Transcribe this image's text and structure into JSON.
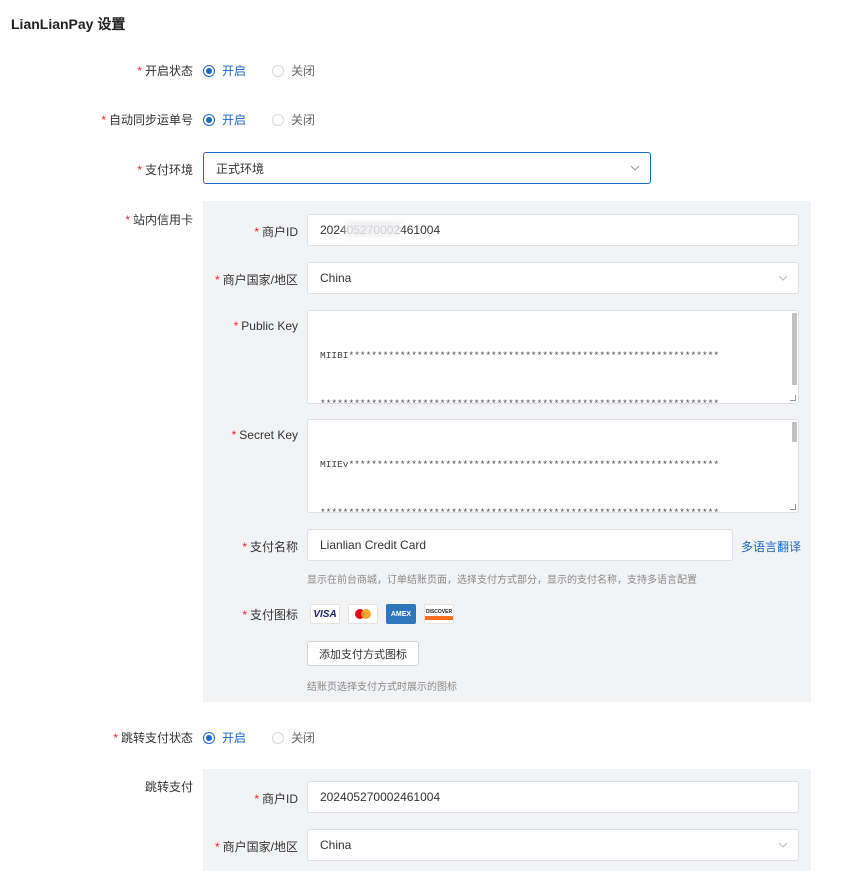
{
  "page": {
    "title": "LianLianPay 设置"
  },
  "required_mark": "*",
  "status": {
    "label": "开启状态",
    "options": [
      "开启",
      "关闭"
    ],
    "selected": "开启"
  },
  "auto_sync": {
    "label": "自动同步运单号",
    "options": [
      "开启",
      "关闭"
    ],
    "selected": "开启"
  },
  "environment": {
    "label": "支付环境",
    "value": "正式环境"
  },
  "onsite_card": {
    "label": "站内信用卡",
    "merchant_id": {
      "label": "商户ID",
      "value": "202405270002461004"
    },
    "country": {
      "label": "商户国家/地区",
      "value": "China"
    },
    "public_key": {
      "label": "Public Key",
      "lines": [
        "MIIBI*****************************************************************",
        "**********************************************************************",
        "**********************************************************************",
        "**********************************************************************",
        "**********************************************************************"
      ]
    },
    "secret_key": {
      "label": "Secret Key",
      "lines": [
        "MIIEv*****************************************************************",
        "**********************************************************************",
        "**********************************************************************",
        "**********************************************************************",
        "**********************************************************************"
      ]
    },
    "payment_name": {
      "label": "支付名称",
      "value": "Lianlian Credit Card",
      "translate_link": "多语言翻译",
      "hint": "显示在前台商城，订单结账页面，选择支付方式部分，显示的支付名称，支持多语言配置"
    },
    "payment_icons": {
      "label": "支付图标",
      "icons": [
        "visa-icon",
        "mastercard-icon",
        "amex-icon",
        "discover-icon"
      ],
      "visa_text": "VISA",
      "amex_text": "AMEX",
      "discover_text": "DISCOVER",
      "add_button": "添加支付方式图标",
      "hint": "结账页选择支付方式时展示的图标"
    }
  },
  "redirect_status": {
    "label": "跳转支付状态",
    "options": [
      "开启",
      "关闭"
    ],
    "selected": "开启"
  },
  "redirect_pay": {
    "label": "跳转支付",
    "merchant_id": {
      "label": "商户ID",
      "value": "202405270002461004"
    },
    "country": {
      "label": "商户国家/地区",
      "value": "China"
    }
  },
  "colors": {
    "primary": "#1b66c9",
    "required": "#f5222d",
    "panel_bg": "#f2f3f5",
    "visa_blue": "#1a1f71",
    "mastercard_red": "#eb001b",
    "mastercard_orange": "#f79e1b",
    "amex_blue": "#2e77bc",
    "discover_orange": "#f76f20"
  }
}
